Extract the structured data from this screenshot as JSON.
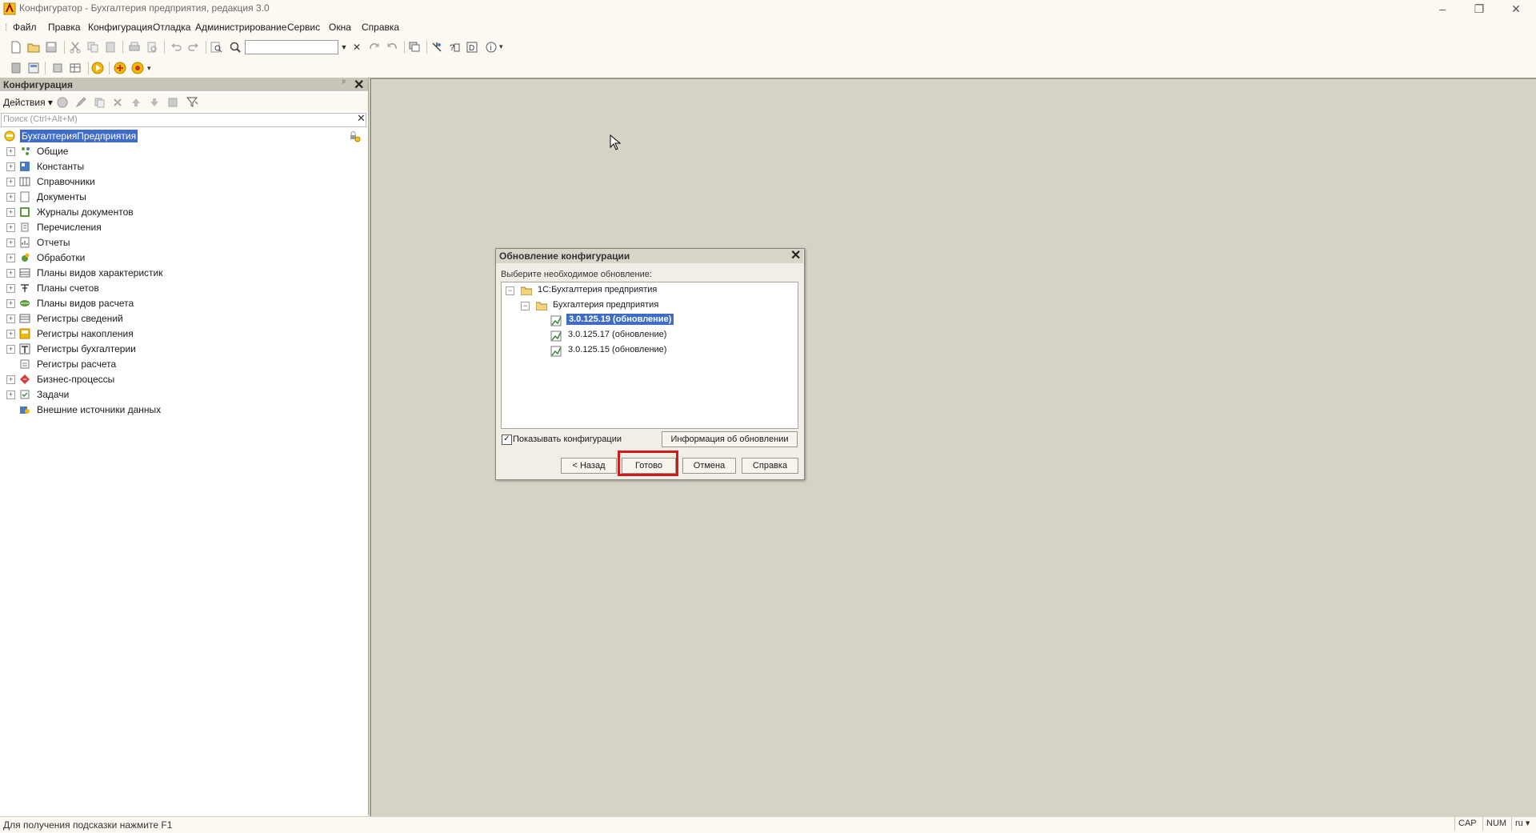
{
  "window": {
    "title": "Конфигуратор - Бухгалтерия предприятия, редакция 3.0",
    "minimize": "–",
    "restore": "❐",
    "close": "✕"
  },
  "menu": [
    "Файл",
    "Правка",
    "Конфигурация",
    "Отладка",
    "Администрирование",
    "Сервис",
    "Окна",
    "Справка"
  ],
  "panel": {
    "title": "Конфигурация",
    "pin": "ᵖ",
    "close": "✕",
    "actions": "Действия ▾",
    "search_placeholder": "Поиск (Ctrl+Alt+M)",
    "search_clear": "✕",
    "root": "БухгалтерияПредприятия",
    "items": [
      "Общие",
      "Константы",
      "Справочники",
      "Документы",
      "Журналы документов",
      "Перечисления",
      "Отчеты",
      "Обработки",
      "Планы видов характеристик",
      "Планы счетов",
      "Планы видов расчета",
      "Регистры сведений",
      "Регистры накопления",
      "Регистры бухгалтерии",
      "Регистры расчета",
      "Бизнес-процессы",
      "Задачи",
      "Внешние источники данных"
    ]
  },
  "dialog": {
    "title": "Обновление конфигурации",
    "close": "✕",
    "prompt": "Выберите необходимое обновление:",
    "tree": {
      "root": "1С:Бухгалтерия предприятия",
      "child": "Бухгалтерия предприятия",
      "updates": [
        "3.0.125.19 (обновление)",
        "3.0.125.17 (обновление)",
        "3.0.125.15 (обновление)"
      ]
    },
    "show_configs_label": "Показывать конфигурации",
    "show_configs_checked": "✓",
    "info_button": "Информация об обновлении",
    "back_button": "< Назад",
    "done_button": "Готово",
    "cancel_button": "Отмена",
    "help_button": "Справка"
  },
  "status": {
    "hint": "Для получения подсказки нажмите F1",
    "cap": "CAP",
    "num": "NUM",
    "lang": "ru ▾"
  },
  "colors": {
    "selection": "#3f6cc7",
    "highlight_frame": "#d11a1a",
    "workspace": "#d6d3c6",
    "chrome": "#fbf9f1"
  }
}
